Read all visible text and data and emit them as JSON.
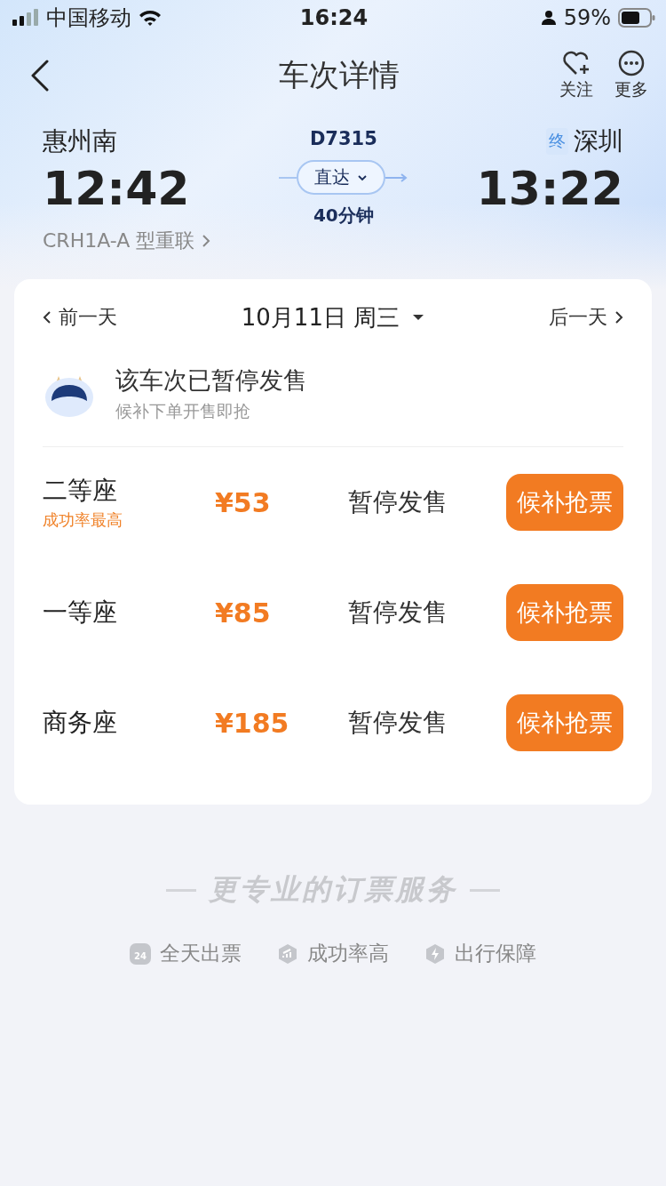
{
  "status_bar": {
    "carrier": "中国移动",
    "time": "16:24",
    "battery": "59%"
  },
  "header": {
    "title": "车次详情",
    "actions": [
      {
        "label": "关注",
        "kind": "follow"
      },
      {
        "label": "更多",
        "kind": "more"
      }
    ]
  },
  "route": {
    "from": {
      "station": "惠州南",
      "time": "12:42"
    },
    "train_no": "D7315",
    "mode": "直达",
    "duration": "40分钟",
    "to": {
      "badge": "终",
      "station": "深圳",
      "time": "13:22"
    },
    "model": "CRH1A-A 型重联"
  },
  "date_bar": {
    "prev": "前一天",
    "date": "10月11日 周三",
    "next": "后一天"
  },
  "notice": {
    "title": "该车次已暂停发售",
    "subtitle": "候补下单开售即抢"
  },
  "seats": [
    {
      "name": "二等座",
      "note": "成功率最高",
      "price": "¥53",
      "status": "暂停发售",
      "button": "候补抢票"
    },
    {
      "name": "一等座",
      "price": "¥85",
      "status": "暂停发售",
      "button": "候补抢票"
    },
    {
      "name": "商务座",
      "price": "¥185",
      "status": "暂停发售",
      "button": "候补抢票"
    }
  ],
  "footer": {
    "slogan": "更专业的订票服务",
    "features": [
      {
        "kind": "clock",
        "badge": "24",
        "label": "全天出票"
      },
      {
        "kind": "chart",
        "label": "成功率高"
      },
      {
        "kind": "bolt",
        "label": "出行保障"
      }
    ]
  }
}
